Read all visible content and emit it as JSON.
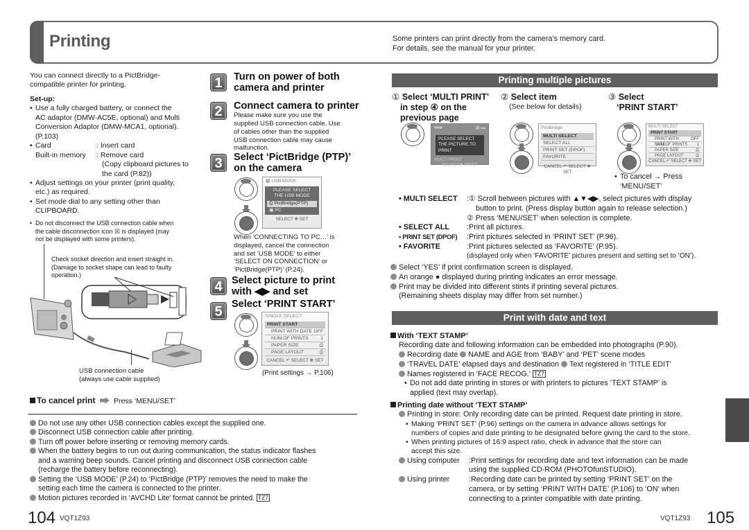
{
  "header": {
    "title": "Printing",
    "note_lines": [
      "Some printers can print directly from the camera’s memory card.",
      "For details, see the manual for your printer."
    ]
  },
  "left": {
    "intro": [
      "You can connect directly to a PictBridge-",
      "compatible printer for printing."
    ],
    "setup_heading": "Set-up:",
    "setup": {
      "battery_lines": [
        "Use a fully charged battery, or connect the",
        "AC adaptor (DMW-AC5E, optional) and Multi",
        "Conversion Adaptor (DMW-MCA1, optional).",
        "(P.103)"
      ],
      "card_key": "Card",
      "card_value": ": Insert card",
      "builtin_key": "Built-in memory",
      "builtin_value": ": Remove card",
      "builtin_note_lines": [
        "(Copy clipboard pictures to",
        "the card (P.82))"
      ],
      "adjust_lines": [
        "Adjust settings on your printer (print quality,",
        "etc.) as required."
      ],
      "mode_lines": [
        "Set mode dial to any setting other than",
        "CLIPBOARD."
      ]
    },
    "disconnect_note_lines": [
      "Do not disconnect the USB connection cable when",
      "the cable disconnection icon ☒ is displayed (may",
      "not be displayed with some printers)."
    ],
    "socket_note_lines": [
      "Check socket direction and insert straight in.",
      "(Damage to socket shape can lead to faulty",
      "operation.)"
    ],
    "cable_caption_lines": [
      "USB connection cable",
      "(always use cable supplied)"
    ],
    "cancel": {
      "label": "To cancel print",
      "action": "Press ‘MENU/SET’"
    },
    "notes": [
      [
        "Do not use any other USB connection cables except the supplied one."
      ],
      [
        "Disconnect USB connection cable after printing."
      ],
      [
        "Turn off power before inserting or removing memory cards."
      ],
      [
        "When the battery begins to run out during communication, the status indicator flashes",
        "and a warning beep sounds. Cancel printing and disconnect USB connection cable",
        "(recharge the battery before reconnecting)."
      ],
      [
        "Setting the ‘USB MODE’ (P.24) to ‘PictBridge (PTP)’ removes the need to make the",
        "setting each time the camera is connected to the printer."
      ],
      [
        "Motion pictures recorded in ‘AVCHD Lite’ format cannot be printed."
      ]
    ],
    "tz7_badge": "TZ7"
  },
  "steps": [
    {
      "num": "1",
      "title_lines": [
        "Turn on power of both",
        "camera and printer"
      ]
    },
    {
      "num": "2",
      "title_lines": [
        "Connect camera to printer"
      ],
      "body_lines": [
        "Please make sure you use the",
        "supplied USB connection cable. Use",
        "of cables other than the supplied",
        "USB connection cable may cause",
        "malfunction."
      ]
    },
    {
      "num": "3",
      "title_lines": [
        "Select ‘PictBridge (PTP)’",
        "on the camera"
      ],
      "body_lines": [
        "When ‘CONNECTING TO PC…’ is",
        "displayed, cancel the connection",
        "and set ‘USB MODE’ to either",
        "‘SELECT ON CONNECTION’ or",
        "‘PictBridge(PTP)’ (P.24)."
      ]
    },
    {
      "num": "4",
      "title_lines": [
        "Select picture to print",
        "with ◀▶ and set"
      ]
    },
    {
      "num": "5",
      "title_lines": [
        "Select ‘PRINT START’"
      ],
      "caption": "(Print settings → P.106)"
    }
  ],
  "screens": {
    "usb_mode": {
      "title": "USB MODE",
      "prompt_lines": [
        "PLEASE SELECT",
        "THE USB MODE"
      ],
      "options": [
        "PictBridge(PTP)",
        "PC"
      ],
      "selected": "PictBridge(PTP)",
      "footer": "SELECT ✥ SET"
    },
    "single_select": {
      "title": "SINGLE SELECT",
      "rows": [
        {
          "label": "PRINT START",
          "value": "",
          "selected": true
        },
        {
          "label": "PRINT WITH DATE",
          "value": "OFF"
        },
        {
          "label": "NUM.OF PRINTS",
          "value": "1"
        },
        {
          "label": "PAPER SIZE",
          "value": "⎙"
        },
        {
          "label": "PAGE LAYOUT",
          "value": "⎙"
        }
      ],
      "footer": "CANCEL ↶ SELECT ✥ SET"
    },
    "playback": {
      "prompt_lines": [
        "PLEASE SELECT",
        "THE PICTURE TO PRINT"
      ],
      "footer_lines": [
        "MULTI PRINT",
        "SELECT✥ PRINT"
      ]
    },
    "pictbridge_menu": {
      "title": "PictBridge",
      "rows": [
        "MULTI SELECT",
        "SELECT ALL",
        "PRINT SET (DPOF)",
        "FAVORITE"
      ],
      "selected": "MULTI SELECT",
      "footer": "CANCEL ↶ SELECT ✥ SET"
    },
    "multi_select": {
      "title": "MULTI SELECT",
      "rows": [
        {
          "label": "PRINT START",
          "value": "",
          "selected": true
        },
        {
          "label": "PRINT WITH DATE",
          "value": "OFF"
        },
        {
          "label": "NUM.OF PRINTS",
          "value": "1"
        },
        {
          "label": "PAPER SIZE",
          "value": "⎙"
        },
        {
          "label": "PAGE LAYOUT",
          "value": "⎙"
        }
      ],
      "footer": "CANCEL ↶ SELECT ✥ SET"
    }
  },
  "right": {
    "multi_heading": "Printing multiple pictures",
    "multi_steps": [
      {
        "marker": "①",
        "title_lines": [
          "Select ‘MULTI PRINT’",
          "in step ④ on the",
          "previous page"
        ]
      },
      {
        "marker": "②",
        "title_lines": [
          "Select item"
        ],
        "sub": "(See below for details)"
      },
      {
        "marker": "③",
        "title_lines": [
          "Select",
          "‘PRINT START’"
        ],
        "cancel_lines": [
          "To cancel → Press",
          "‘MENU/SET’"
        ]
      }
    ],
    "items": [
      {
        "key": "MULTI SELECT",
        "lines": [
          ":① Scroll between pictures with ▲▼◀▶, select pictures with display",
          "   button to print. (Press display button again to release selection.)",
          " ② Press ‘MENU/SET’ when selection is complete."
        ]
      },
      {
        "key": "SELECT ALL",
        "lines": [
          ":Print all pictures."
        ]
      },
      {
        "key": "PRINT SET (DPOF)",
        "lines": [
          ":Print pictures selected in ‘PRINT SET’ (P.96)."
        ]
      },
      {
        "key": "FAVORITE",
        "lines": [
          ":Print pictures selected as ‘FAVORITE’ (P.95).",
          " (displayed only when ‘FAVORITE’ pictures present and setting set to ‘ON’)."
        ]
      }
    ],
    "multi_notes": [
      [
        "Select ‘YES’ if print confirmation screen is displayed."
      ],
      [
        "An orange ● displayed during printing indicates an error message."
      ],
      [
        "Print may be divided into different stints if printing several pictures.",
        "(Remaining sheets display may differ from set number.)"
      ]
    ],
    "date_heading": "Print with date and text",
    "text_stamp": {
      "heading": "With ‘TEXT STAMP’",
      "intro": "Recording date and following information can be embedded into photographs (P.90).",
      "bullets": [
        [
          "Recording date",
          "NAME and AGE from ‘BABY’ and ‘PET’ scene modes"
        ],
        [
          "‘TRAVEL DATE’ elapsed days and destination",
          "Text registered in ‘TITLE EDIT’"
        ],
        [
          "Names registered in ‘FACE RECOG.’"
        ]
      ],
      "warning_lines": [
        "Do not add date printing in stores or with printers to pictures ‘TEXT STAMP’ is",
        "applied (text may overlap)."
      ]
    },
    "without_stamp": {
      "heading": "Printing date without ‘TEXT STAMP’",
      "store": "Printing in store: Only recording date can be printed. Request date printing in store.",
      "store_subs": [
        [
          "Making ‘PRINT SET’ (P.96) settings on the camera in advance allows settings for",
          "numbers of copies and date printing to be designated before giving the card to the store."
        ],
        [
          "When printing pictures of 16:9 aspect ratio, check in advance that the store can",
          "accept this size."
        ]
      ],
      "computer_key": "Using computer",
      "computer_lines": [
        ":Print settings for recording date and text information can be made",
        " using the supplied CD-ROM (PHOTOfunSTUDIO)."
      ],
      "printer_key": "Using printer",
      "printer_lines": [
        ":Recording date can be printed by setting ‘PRINT SET’ on the",
        " camera, or by setting ‘PRINT WITH DATE’ (P.106) to ‘ON’ when",
        " connecting to a printer compatible with date printing."
      ]
    }
  },
  "footer": {
    "left_page": "104",
    "left_code": "VQT1Z93",
    "right_page": "105",
    "right_code": "VQT1Z93"
  }
}
